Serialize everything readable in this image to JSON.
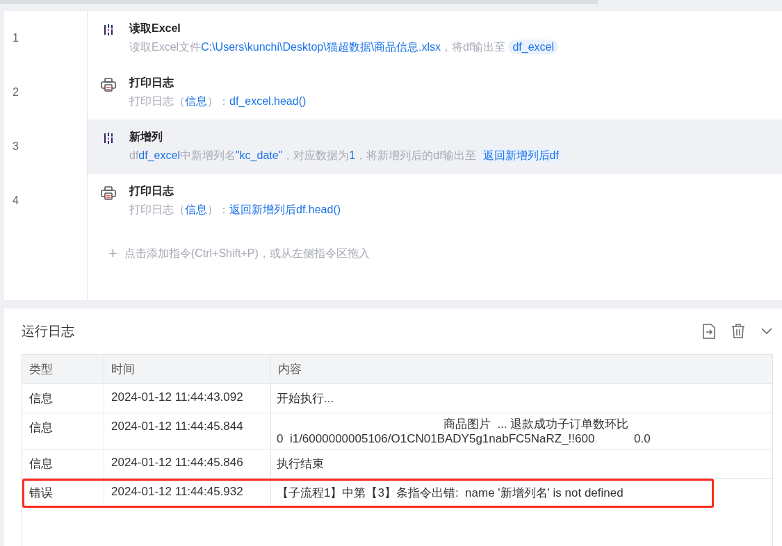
{
  "steps": [
    {
      "number": "1",
      "kind": "data",
      "title": "读取Excel",
      "selected": false,
      "parts": [
        {
          "kind": "plain",
          "text": "读取Excel文件"
        },
        {
          "kind": "value",
          "text": "C:\\Users\\kunchi\\Desktop\\猫超数据\\商品信息.xlsx"
        },
        {
          "kind": "plain",
          "text": "，将df输出至"
        },
        {
          "kind": "chip",
          "text": "df_excel"
        }
      ]
    },
    {
      "number": "2",
      "kind": "log",
      "title": "打印日志",
      "selected": false,
      "parts": [
        {
          "kind": "plain",
          "text": "打印日志（"
        },
        {
          "kind": "value",
          "text": "信息"
        },
        {
          "kind": "plain",
          "text": "）："
        },
        {
          "kind": "value",
          "text": "df_excel.head()"
        }
      ]
    },
    {
      "number": "3",
      "kind": "data",
      "title": "新增列",
      "selected": true,
      "parts": [
        {
          "kind": "plain",
          "text": "df"
        },
        {
          "kind": "value",
          "text": "df_excel"
        },
        {
          "kind": "plain",
          "text": "中新增列名"
        },
        {
          "kind": "value",
          "text": "\"kc_date\""
        },
        {
          "kind": "plain",
          "text": "，对应数据为"
        },
        {
          "kind": "value",
          "text": "1"
        },
        {
          "kind": "plain",
          "text": "，将新增列后的df输出至"
        },
        {
          "kind": "chip",
          "text": "返回新增列后df"
        }
      ]
    },
    {
      "number": "4",
      "kind": "log",
      "title": "打印日志",
      "selected": false,
      "parts": [
        {
          "kind": "plain",
          "text": "打印日志（"
        },
        {
          "kind": "value",
          "text": "信息"
        },
        {
          "kind": "plain",
          "text": "）："
        },
        {
          "kind": "value",
          "text": "返回新增列后df.head()"
        }
      ]
    }
  ],
  "add_hint": {
    "icon": "+",
    "text": "点击添加指令(Ctrl+Shift+P)，或从左侧指令区拖入"
  },
  "log": {
    "title": "运行日志",
    "columns": [
      "类型",
      "时间",
      "内容"
    ],
    "rows": [
      {
        "type": "信息",
        "time": "2024-01-12 11:44:43.092",
        "content": [
          "开始执行..."
        ],
        "highlighted": false
      },
      {
        "type": "信息",
        "time": "2024-01-12 11:44:45.844",
        "content": [
          "商品图片  ... 退款成功子订单数环比",
          "0  i1/6000000005106/O1CN01BADY5g1nabFC5NaRZ_!!600            0.0"
        ],
        "highlighted": false
      },
      {
        "type": "信息",
        "time": "2024-01-12 11:44:45.846",
        "content": [
          "执行结束"
        ],
        "highlighted": false
      },
      {
        "type": "错误",
        "time": "2024-01-12 11:44:45.932",
        "content": [
          "【子流程1】中第【3】条指令出错:  name '新增列名' is not defined"
        ],
        "highlighted": true
      }
    ]
  }
}
